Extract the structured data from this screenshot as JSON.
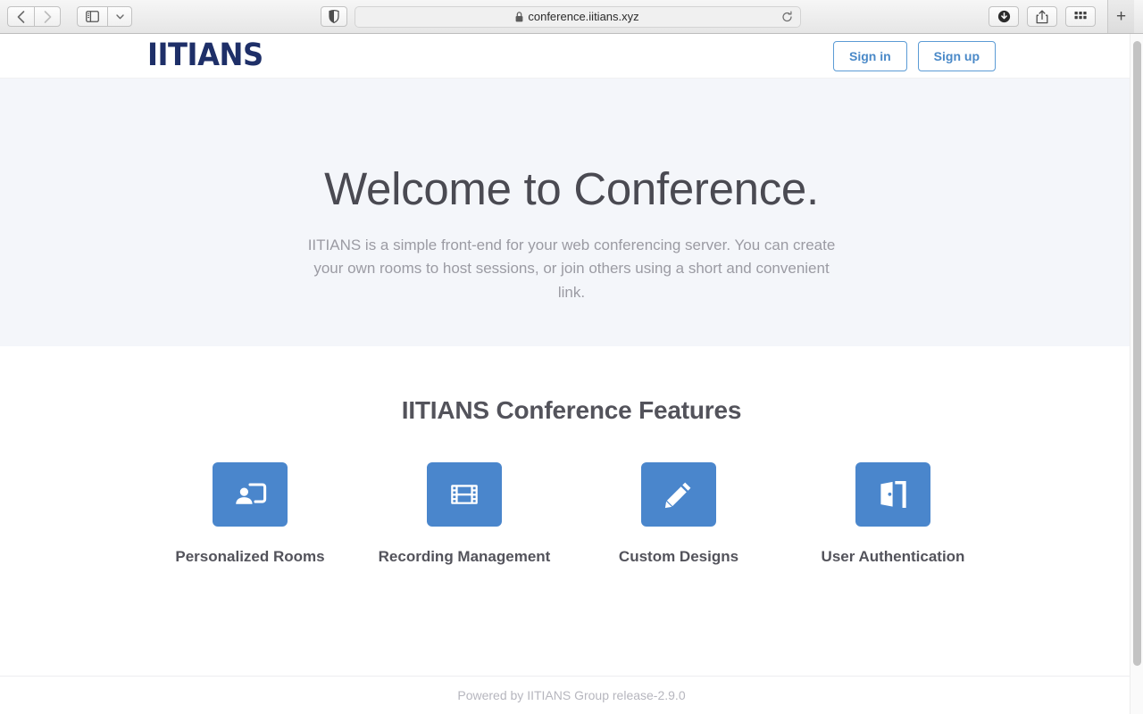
{
  "browser": {
    "back_icon": "chevron-left-icon",
    "forward_icon": "chevron-right-icon",
    "sidebar_icon": "sidebar-toggle-icon",
    "sidebar_caret_icon": "chevron-down-icon",
    "shield_icon": "privacy-shield-icon",
    "url": "conference.iitians.xyz",
    "lock_icon": "lock-icon",
    "reload_icon": "reload-icon",
    "downloads_icon": "downloads-icon",
    "share_icon": "share-icon",
    "tab_overview_icon": "tab-overview-icon",
    "new_tab_label": "+"
  },
  "header": {
    "logo_text": "IITIANS",
    "sign_in_label": "Sign in",
    "sign_up_label": "Sign up"
  },
  "hero": {
    "title": "Welcome to Conference.",
    "subtitle": "IITIANS is a simple front-end for your web conferencing server. You can create your own rooms to host sessions, or join others using a short and convenient link."
  },
  "features": {
    "title": "IITIANS Conference Features",
    "items": [
      {
        "label": "Personalized Rooms",
        "icon": "present-to-person-icon"
      },
      {
        "label": "Recording Management",
        "icon": "film-strip-icon"
      },
      {
        "label": "Custom Designs",
        "icon": "pencil-icon"
      },
      {
        "label": "User Authentication",
        "icon": "door-exit-icon"
      }
    ]
  },
  "footer": {
    "text": "Powered by IITIANS Group release-2.9.0"
  },
  "colors": {
    "brand_navy": "#1e2f68",
    "accent_blue": "#4a86cc",
    "link_blue": "#4a89c8",
    "hero_background": "#f4f6fa",
    "heading_gray": "#53535b",
    "muted_gray": "#9b9ba3"
  }
}
